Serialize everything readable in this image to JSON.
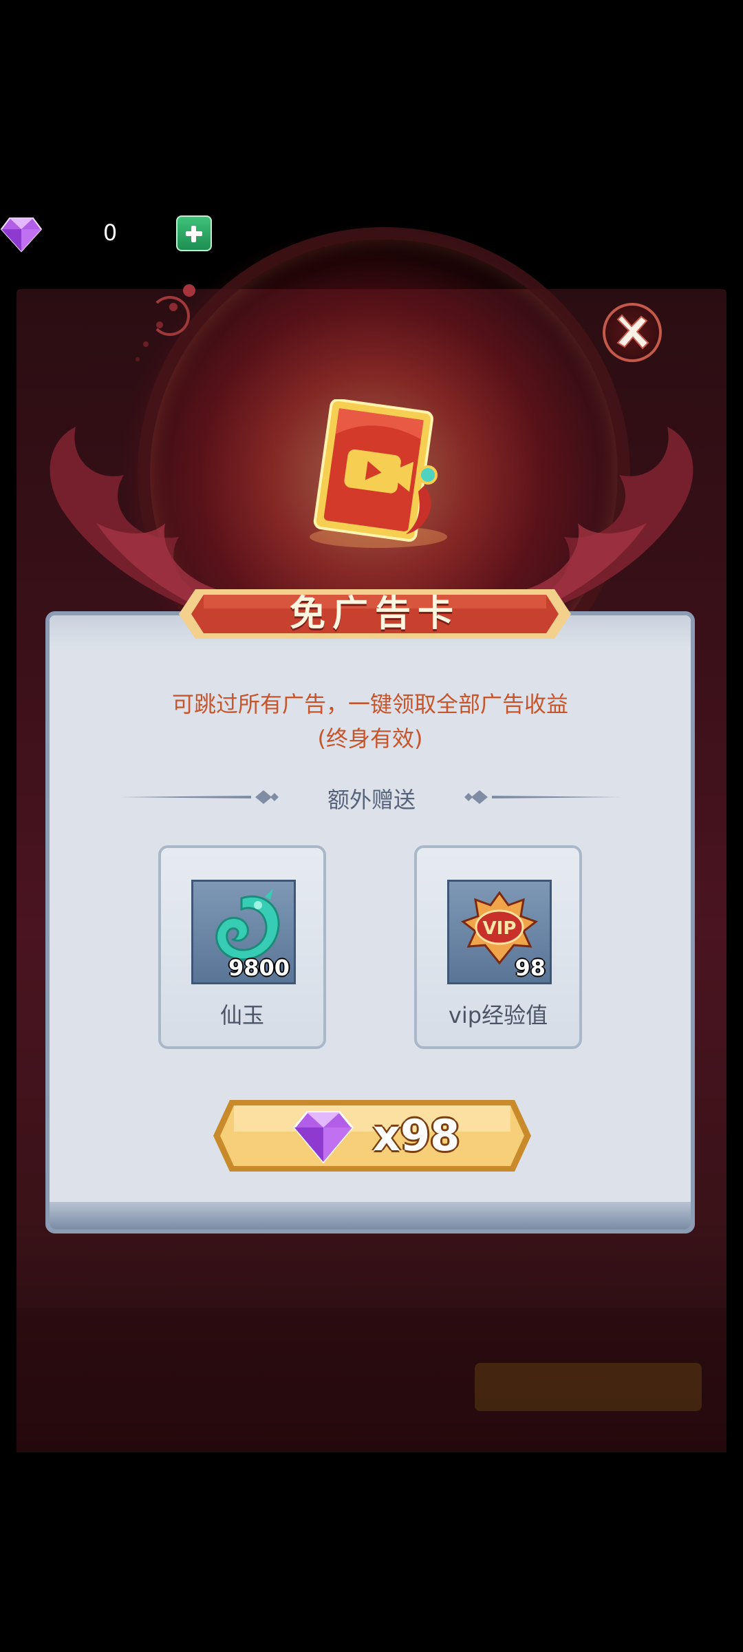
{
  "currency": {
    "amount": "0"
  },
  "dialog": {
    "title": "免广告卡",
    "description_line1": "可跳过所有广告，一键领取全部广告收益",
    "description_line2": "(终身有效)",
    "bonus_title": "额外赠送",
    "rewards": [
      {
        "name": "仙玉",
        "count": "9800",
        "icon": "jade-dragon-icon"
      },
      {
        "name": "vip经验值",
        "count": "98",
        "icon": "vip-badge-icon"
      }
    ],
    "purchase": {
      "label": "x98",
      "icon": "diamond-icon"
    }
  },
  "colors": {
    "accent_red": "#c7552c",
    "banner_red": "#c8402e",
    "button_gold": "#f5c46a",
    "panel": "#dde2ea"
  }
}
